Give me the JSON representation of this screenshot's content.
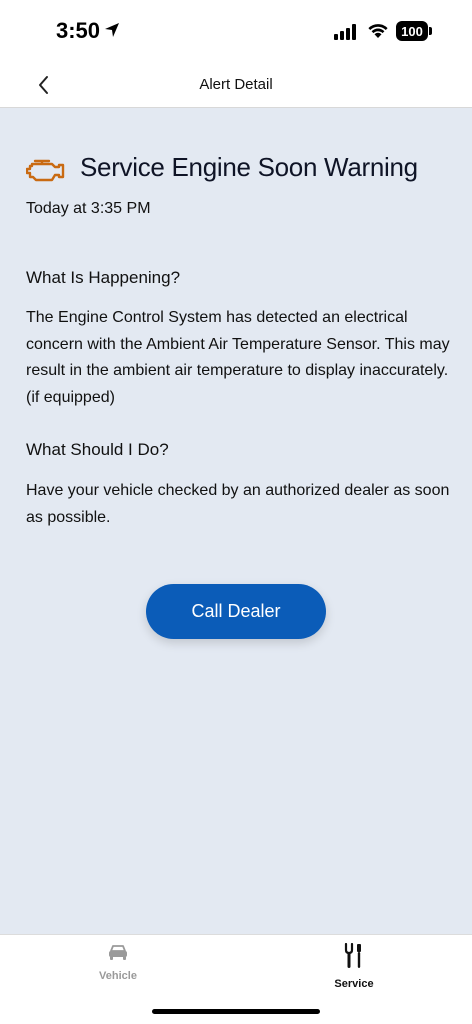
{
  "status_bar": {
    "time": "3:50",
    "battery": "100"
  },
  "nav": {
    "title": "Alert Detail"
  },
  "alert": {
    "title": "Service Engine Soon Warning",
    "time": "Today at 3:35 PM",
    "icon": "check-engine-icon",
    "icon_color": "#c96a12"
  },
  "sections": [
    {
      "heading": "What Is Happening?",
      "body": "The Engine Control System has detected an electrical concern with the Ambient Air Temperature Sensor. This may result in the ambient air temperature to display inaccurately.  (if equipped)"
    },
    {
      "heading": "What Should I Do?",
      "body": "Have your vehicle checked by an authorized dealer as soon as possible."
    }
  ],
  "actions": {
    "call_dealer_label": "Call Dealer",
    "button_color": "#0b5cb8"
  },
  "tabs": [
    {
      "label": "Vehicle",
      "icon": "car-icon",
      "active": false
    },
    {
      "label": "Service",
      "icon": "tools-icon",
      "active": true
    }
  ]
}
